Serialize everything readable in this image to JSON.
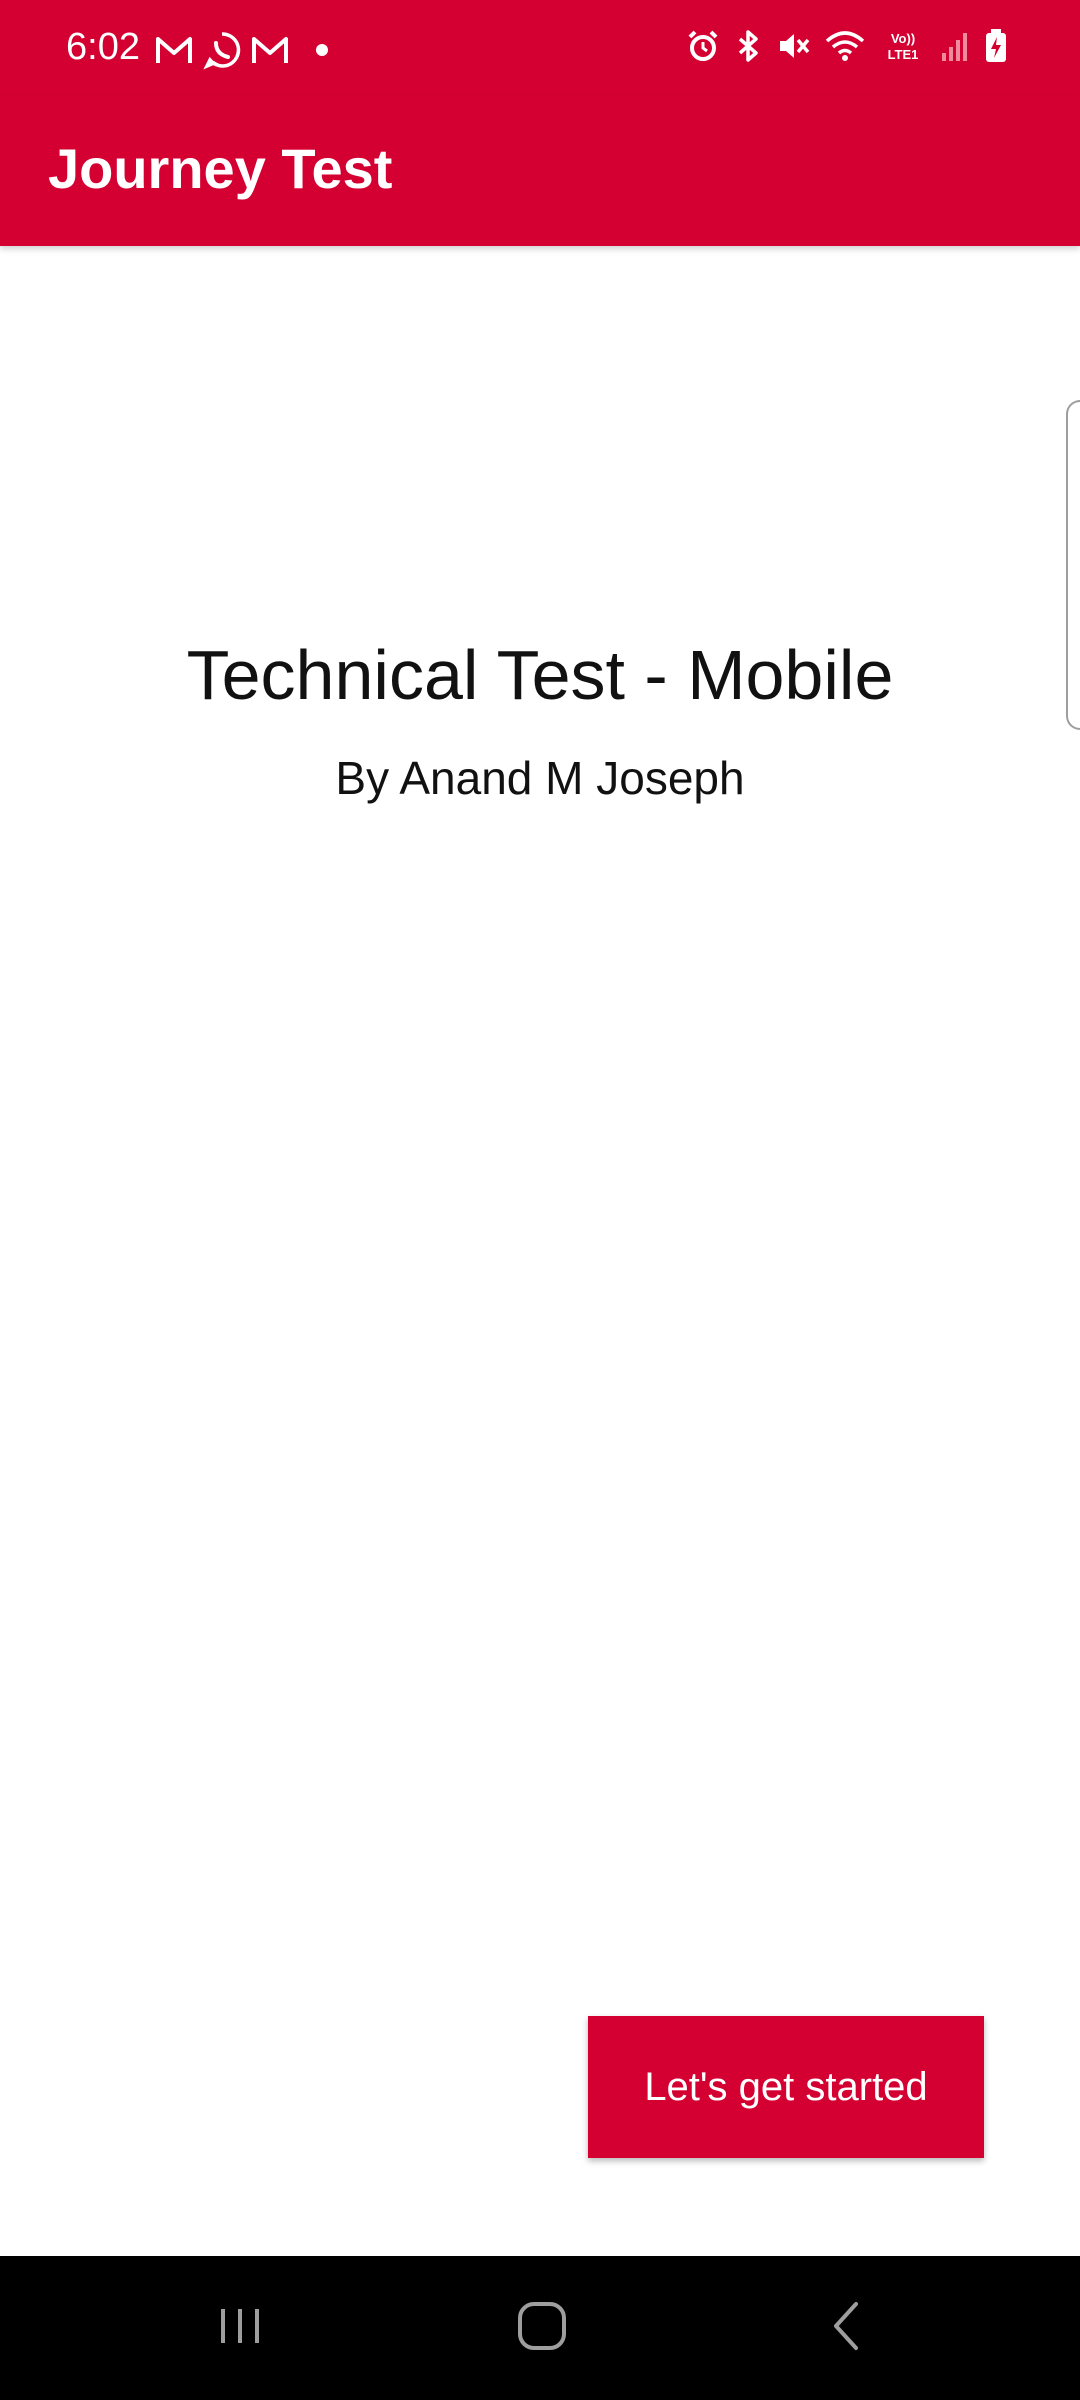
{
  "status_bar": {
    "time": "6:02",
    "left_icons": [
      "gmail-icon",
      "whatsapp-icon",
      "gmail-icon",
      "notification-dot-icon"
    ],
    "right_icons": [
      "alarm-icon",
      "bluetooth-icon",
      "mute-icon",
      "wifi-icon",
      "volte-icon",
      "signal-icon",
      "battery-charging-icon"
    ],
    "volte_label": "Vo)) LTE1",
    "background": "#d50032"
  },
  "app_bar": {
    "title": "Journey Test",
    "background": "#d50032"
  },
  "main": {
    "title": "Technical Test - Mobile",
    "subtitle": "By Anand M Joseph"
  },
  "actions": {
    "start_label": "Let's get started",
    "accent": "#d50032"
  },
  "nav_bar": {
    "buttons": [
      "recents-icon",
      "home-icon",
      "back-icon"
    ]
  }
}
